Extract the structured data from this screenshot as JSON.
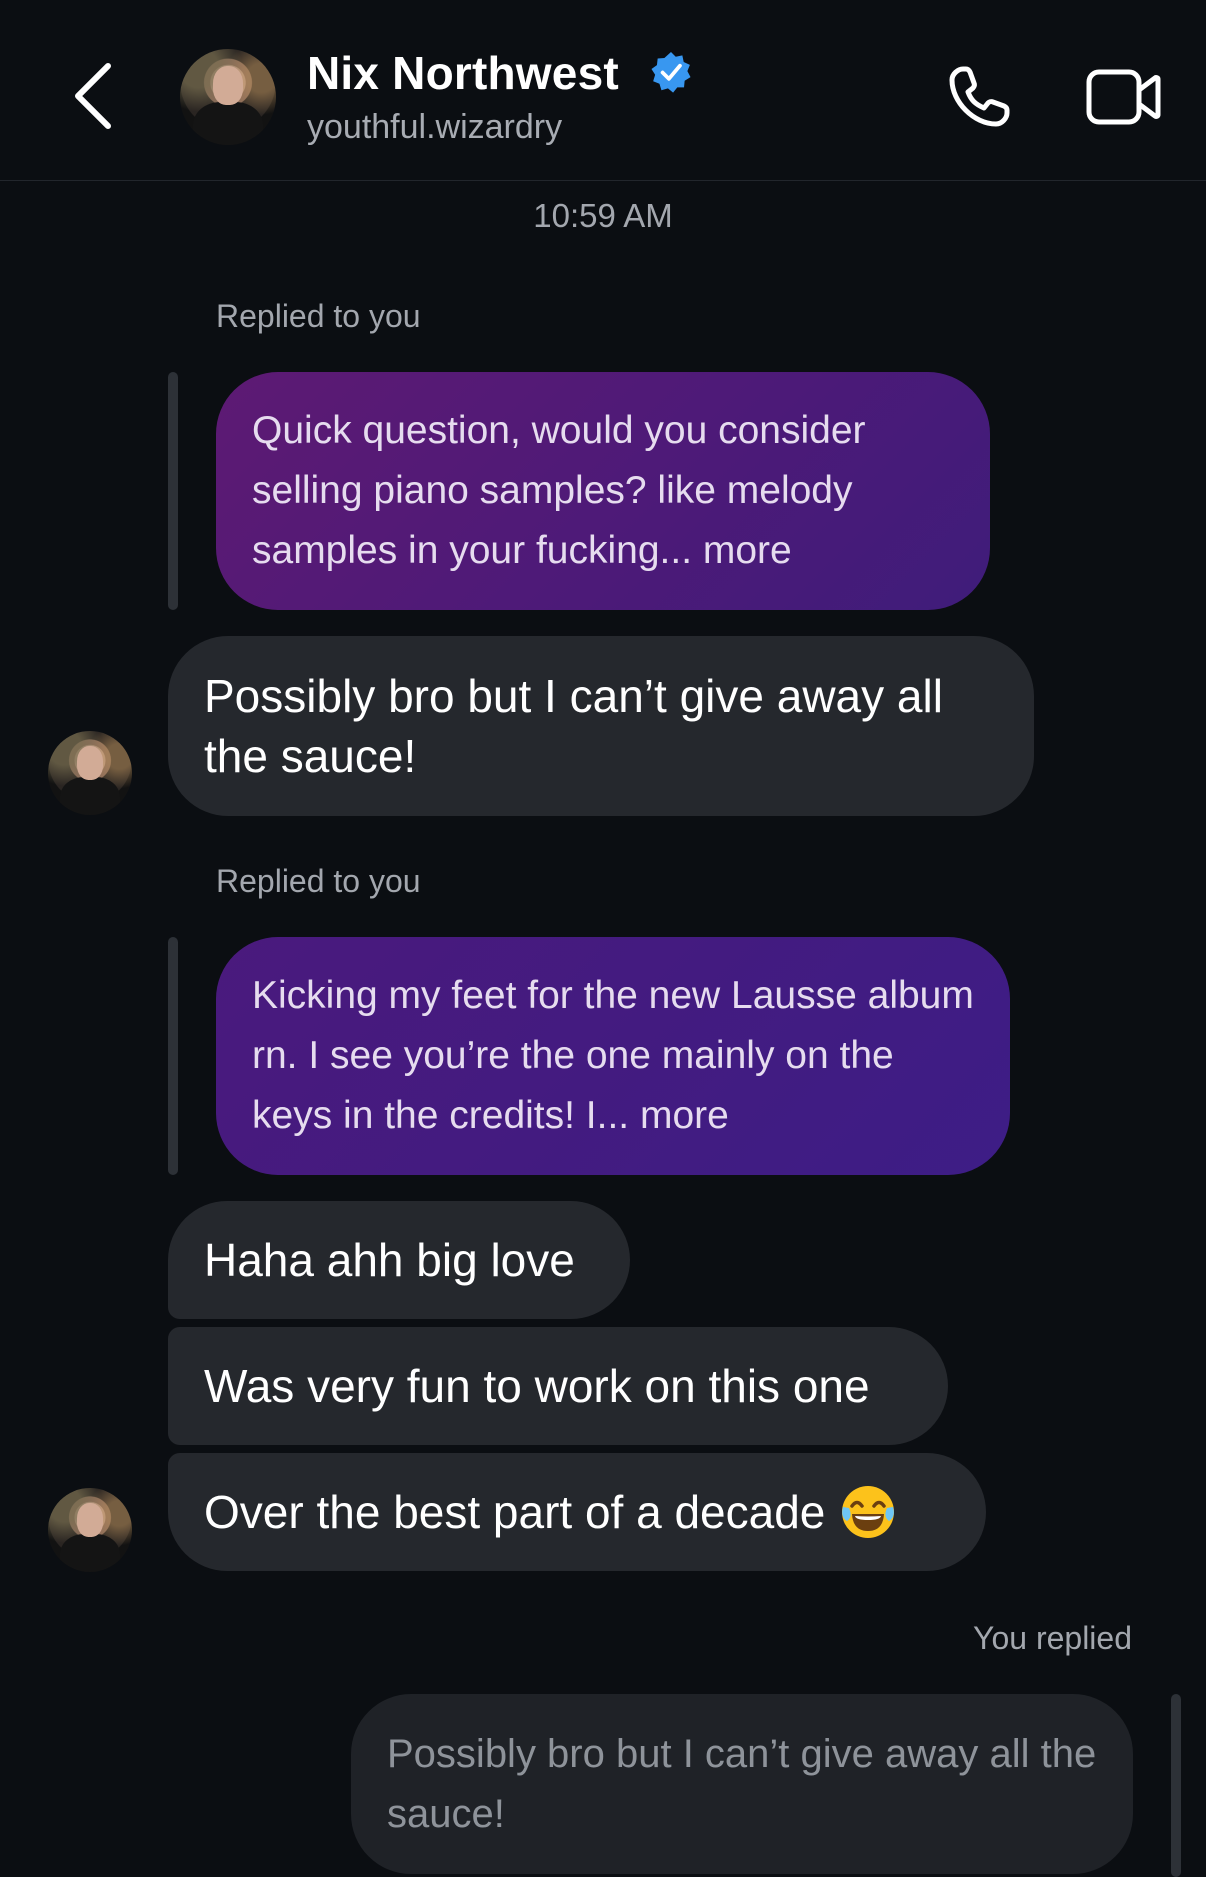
{
  "header": {
    "name": "Nix Northwest",
    "handle": "youthful.wizardry",
    "verified": true,
    "accent_color": "#3897f0"
  },
  "conversation": {
    "timestamp": "10:59 AM",
    "messages": [
      {
        "reply_label": "Replied to you",
        "quoted_text": "Quick question, would you consider selling piano samples? like melody samples in your fucking... more",
        "text": "Possibly bro but I can’t give away all the sauce!"
      },
      {
        "reply_label": "Replied to you",
        "quoted_text": "Kicking my feet for the new Lausse album rn. I see you’re the one mainly on the keys in the credits! I... more"
      },
      {
        "text": "Haha ahh big love"
      },
      {
        "text": "Was very fun to work on this one"
      },
      {
        "text": "Over the best part of a decade",
        "emoji": "face-with-tears-of-joy"
      },
      {
        "reply_label": "You replied",
        "quoted_text": "Possibly bro but I can’t give away all the sauce!"
      }
    ]
  },
  "colors": {
    "background": "#0b0e12",
    "incoming_bubble": "#25282d",
    "quoted_bubble_purple": "#5d1a73",
    "outgoing_quoted_bubble": "#1f2227"
  }
}
